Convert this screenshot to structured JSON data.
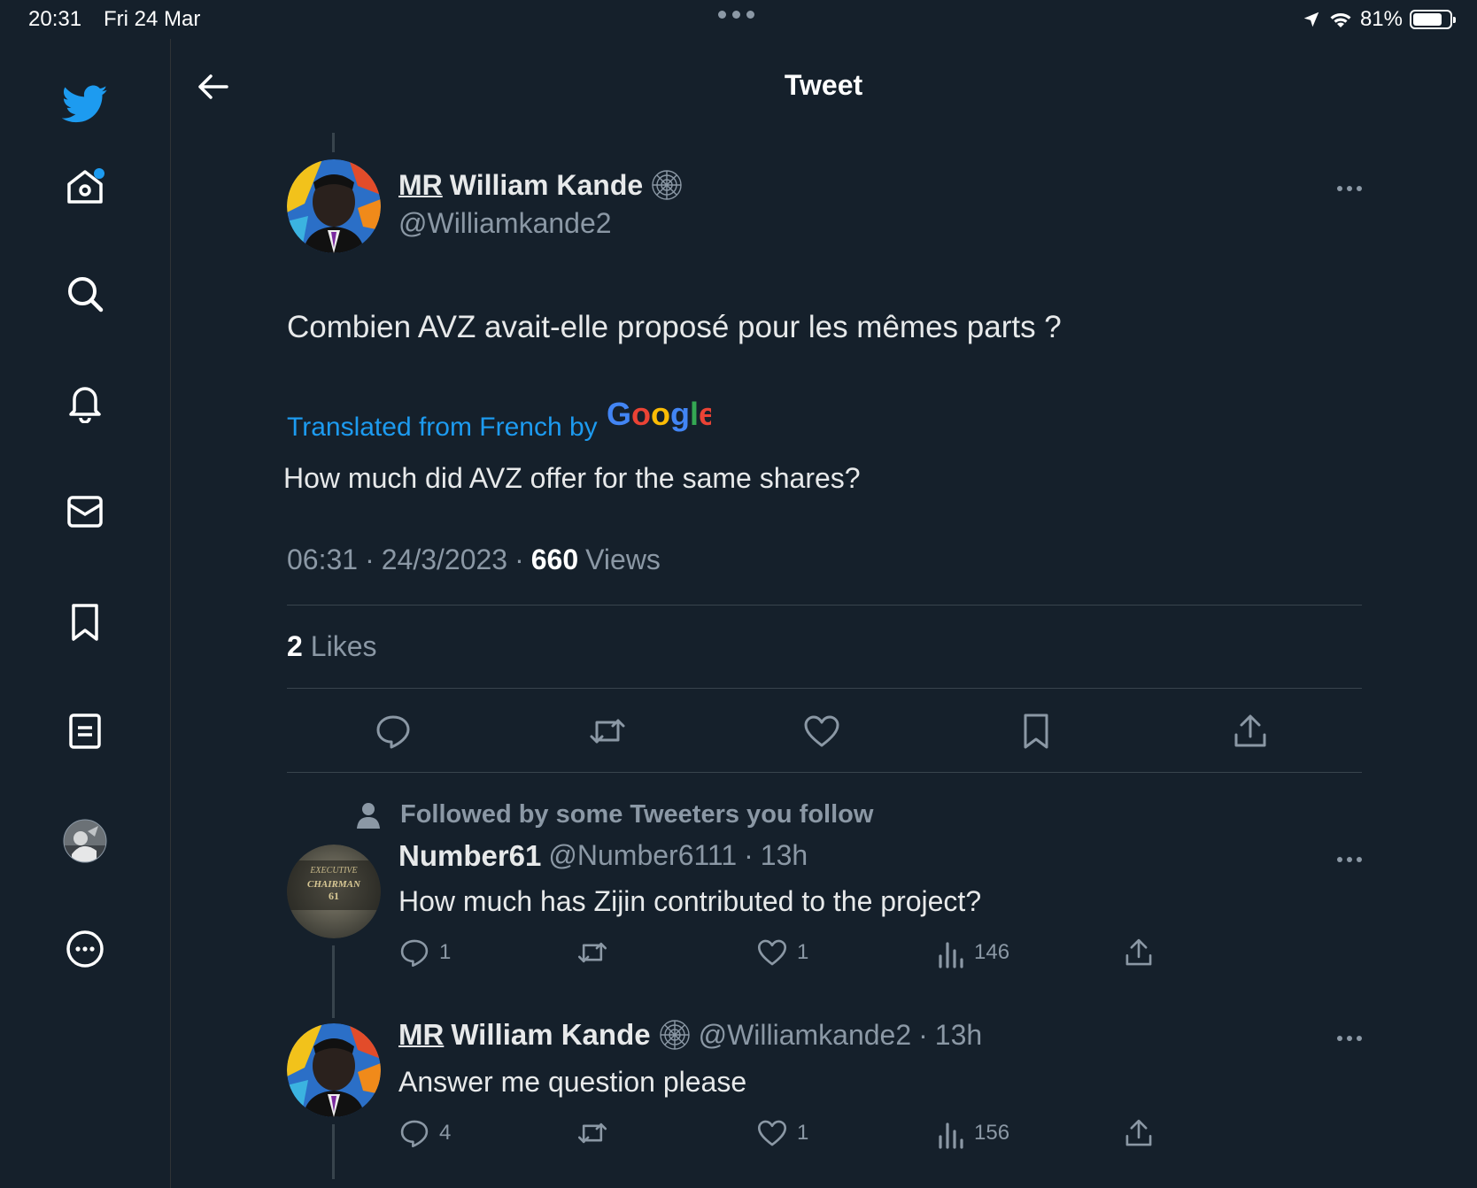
{
  "status_bar": {
    "time": "20:31",
    "date": "Fri 24 Mar",
    "battery": "81%"
  },
  "header": {
    "title": "Tweet"
  },
  "sidebar": {
    "items": [
      "home-icon",
      "search-icon",
      "bell-icon",
      "mail-icon",
      "bookmark-icon",
      "lists-icon",
      "avatar",
      "more-icon"
    ]
  },
  "tweet": {
    "author": {
      "name": "William Kande",
      "name_prefix": "MR",
      "handle": "@Williamkande2"
    },
    "text": "Combien AVZ avait-elle proposé pour les mêmes parts ?",
    "translated_label": "Translated from French by",
    "google_logo": "Google",
    "translation": "How much did AVZ offer for the same shares?",
    "time": "06:31",
    "date": "24/3/2023",
    "separator": "·",
    "views_count": "660",
    "views_label": "Views",
    "likes_count": "2",
    "likes_label": "Likes"
  },
  "context_label": "Followed by some Tweeters you follow",
  "replies": [
    {
      "name": "Number61",
      "handle": "@Number6111",
      "age": "13h",
      "avatar_text": [
        "EXECUTIVE",
        "CHAIRMAN",
        "61"
      ],
      "text": "How much has Zijin contributed to the project?",
      "reply_count": "1",
      "like_count": "1",
      "view_count": "146"
    },
    {
      "name": "William Kande",
      "name_prefix": "MR",
      "handle": "@Williamkande2",
      "age": "13h",
      "text": "Answer me question please",
      "reply_count": "4",
      "like_count": "1",
      "view_count": "156"
    }
  ],
  "colors": {
    "background": "#15202b",
    "accent": "#1d9bf0",
    "muted": "#8b98a5",
    "divider": "#38444d"
  }
}
